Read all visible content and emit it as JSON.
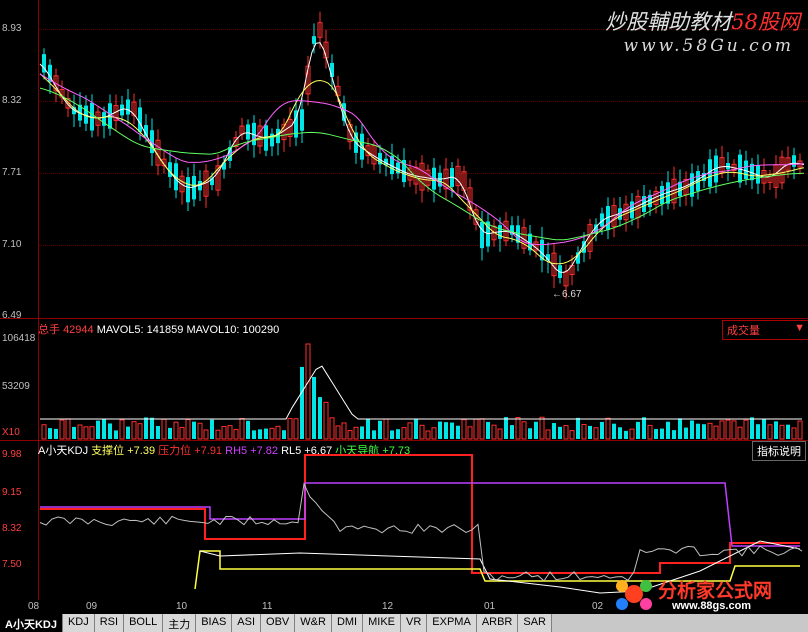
{
  "watermark": {
    "line1_a": "炒股輔助教材",
    "line1_b": "58股网",
    "line2": "www.58Gu.com"
  },
  "price_axis": [
    "8.93",
    "8.32",
    "7.71",
    "7.10",
    "6.49"
  ],
  "low_label": "6.67",
  "volume_panel": {
    "label_total": "总手",
    "total_value": "42944",
    "mavol5_label": "MAVOL5:",
    "mavol5_value": "141859",
    "mavol10_label": "MAVOL10:",
    "mavol10_value": "100290",
    "selector": "成交量",
    "axis": [
      "106418",
      "53209",
      "X10"
    ]
  },
  "kdj_panel": {
    "name": "A小天KDJ",
    "support_label": "支撑位",
    "support_value": "+7.39",
    "pressure_label": "压力位",
    "pressure_value": "+7.91",
    "rh5_label": "RH5",
    "rh5_value": "+7.82",
    "rl5_label": "RL5",
    "rl5_value": "+6.67",
    "nav_label": "小天导航",
    "nav_value": "+7.73",
    "help_button": "指标说明",
    "axis": [
      "9.98",
      "9.15",
      "8.32",
      "7.50"
    ]
  },
  "dates": [
    "08",
    "09",
    "10",
    "11",
    "12",
    "01",
    "02"
  ],
  "tabs": [
    "A小天KDJ",
    "KDJ",
    "RSI",
    "BOLL",
    "主力",
    "BIAS",
    "ASI",
    "OBV",
    "W&R",
    "DMI",
    "MIKE",
    "VR",
    "EXPMA",
    "ARBR",
    "SAR"
  ],
  "logo": {
    "title": "分析家公式网",
    "url": "www.88gs.com"
  },
  "colors": {
    "up": "#ff3030",
    "down": "#00e5e5",
    "pressure": "#ff2020",
    "support": "#ffff40",
    "rh5": "#c040ff"
  },
  "chart_data": {
    "type": "candlestick",
    "price_range": [
      6.49,
      8.93
    ],
    "low_annotation": 6.67
  }
}
